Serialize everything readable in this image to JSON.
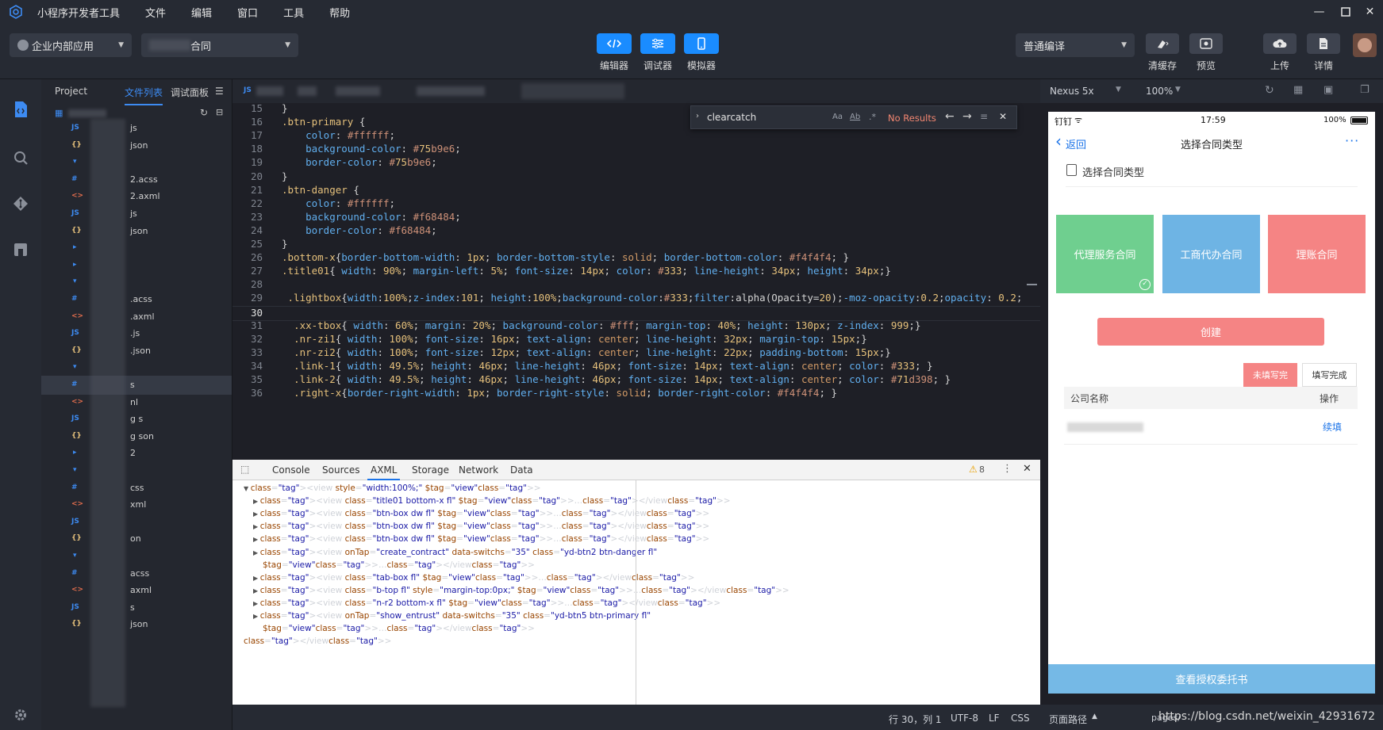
{
  "titlebar": {
    "app_name": "小程序开发者工具",
    "menu": [
      "文件",
      "编辑",
      "窗口",
      "工具",
      "帮助"
    ]
  },
  "toolbar": {
    "app_scope": "企业内部应用",
    "project_name_suffix": "合同",
    "editor_label": "编辑器",
    "debugger_label": "调试器",
    "simulator_label": "模拟器",
    "compile_mode": "普通编译",
    "clear_cache_label": "清缓存",
    "preview_label": "预览",
    "upload_label": "上传",
    "details_label": "详情"
  },
  "tree": {
    "tab_project": "Project",
    "tab_files": "文件列表",
    "tab_debug": "调试面板",
    "rows": [
      {
        "icon": "JS",
        "name": "js"
      },
      {
        "icon": "{}",
        "name": "json"
      },
      {
        "icon": "▾",
        "name": ""
      },
      {
        "icon": "#",
        "name": "2.acss"
      },
      {
        "icon": "<>",
        "name": "2.axml"
      },
      {
        "icon": "JS",
        "name": "js"
      },
      {
        "icon": "{}",
        "name": "json"
      },
      {
        "icon": "▸",
        "name": ""
      },
      {
        "icon": "▸",
        "name": ""
      },
      {
        "icon": "▾",
        "name": ""
      },
      {
        "icon": "#",
        "name": ".acss"
      },
      {
        "icon": "<>",
        "name": ".axml"
      },
      {
        "icon": "JS",
        "name": ".js"
      },
      {
        "icon": "{}",
        "name": ".json"
      },
      {
        "icon": "▾",
        "name": ""
      },
      {
        "icon": "#",
        "name": "s"
      },
      {
        "icon": "<>",
        "name": "nl"
      },
      {
        "icon": "JS",
        "name": "g s"
      },
      {
        "icon": "{}",
        "name": "g son"
      },
      {
        "icon": "▸",
        "name": "2"
      },
      {
        "icon": "▾",
        "name": ""
      },
      {
        "icon": "#",
        "name": "css"
      },
      {
        "icon": "<>",
        "name": "xml"
      },
      {
        "icon": "JS",
        "name": ""
      },
      {
        "icon": "{}",
        "name": "on"
      },
      {
        "icon": "▾",
        "name": ""
      },
      {
        "icon": "#",
        "name": "acss"
      },
      {
        "icon": "<>",
        "name": "axml"
      },
      {
        "icon": "JS",
        "name": "s"
      },
      {
        "icon": "{}",
        "name": "json"
      }
    ]
  },
  "editor": {
    "find_query": "clearcatch",
    "find_result": "No Results",
    "lines": [
      {
        "n": "15",
        "t": "}"
      },
      {
        "n": "16",
        "t": ".btn-primary {"
      },
      {
        "n": "17",
        "t": "    color: #ffffff;"
      },
      {
        "n": "18",
        "t": "    background-color: #75b9e6;"
      },
      {
        "n": "19",
        "t": "    border-color: #75b9e6;"
      },
      {
        "n": "20",
        "t": "}"
      },
      {
        "n": "21",
        "t": ".btn-danger {"
      },
      {
        "n": "22",
        "t": "    color: #ffffff;"
      },
      {
        "n": "23",
        "t": "    background-color: #f68484;"
      },
      {
        "n": "24",
        "t": "    border-color: #f68484;"
      },
      {
        "n": "25",
        "t": "}"
      },
      {
        "n": "26",
        "t": ".bottom-x{border-bottom-width: 1px; border-bottom-style: solid; border-bottom-color: #f4f4f4; }"
      },
      {
        "n": "27",
        "t": ".title01{ width: 90%; margin-left: 5%; font-size: 14px; color: #333; line-height: 34px; height: 34px;}"
      },
      {
        "n": "28",
        "t": ""
      },
      {
        "n": "29",
        "t": " .lightbox{width:100%;z-index:101; height:100%;background-color:#333;filter:alpha(Opacity=20);-moz-opacity:0.2;opacity: 0.2;"
      },
      {
        "n": "30",
        "t": ""
      },
      {
        "n": "31",
        "t": "  .xx-tbox{ width: 60%; margin: 20%; background-color: #fff; margin-top: 40%; height: 130px; z-index: 999;}"
      },
      {
        "n": "32",
        "t": "  .nr-zi1{ width: 100%; font-size: 16px; text-align: center; line-height: 32px; margin-top: 15px;}"
      },
      {
        "n": "33",
        "t": "  .nr-zi2{ width: 100%; font-size: 12px; text-align: center; line-height: 22px; padding-bottom: 15px;}"
      },
      {
        "n": "34",
        "t": "  .link-1{ width: 49.5%; height: 46px; line-height: 46px; font-size: 14px; text-align: center; color: #333; }"
      },
      {
        "n": "35",
        "t": "  .link-2{ width: 49.5%; height: 46px; line-height: 46px; font-size: 14px; text-align: center; color: #71d398; }"
      },
      {
        "n": "36",
        "t": "  .right-x{border-right-width: 1px; border-right-style: solid; border-right-color: #f4f4f4; }"
      }
    ]
  },
  "devtools": {
    "tabs": [
      "Console",
      "Sources",
      "AXML",
      "Storage",
      "Network",
      "Data"
    ],
    "active_tab": "AXML",
    "warning_count": "8",
    "axml_lines": [
      "<view style=\"width:100%;\" $tag=\"view\">",
      "<view class=\"title01 bottom-x fl\" $tag=\"view\">…</view>",
      "<view class=\"btn-box dw fl\" $tag=\"view\">…</view>",
      "<view class=\"btn-box dw fl\" $tag=\"view\">…</view>",
      "<view class=\"btn-box dw fl\" $tag=\"view\">…</view>",
      "<view onTap=\"create_contract\" data-switchs=\"35\" class=\"yd-btn2 btn-danger fl\"",
      "$tag=\"view\">…</view>",
      "<view class=\"tab-box fl\" $tag=\"view\">…</view>",
      "<view class=\"b-top fl\" style=\"margin-top:0px;\" $tag=\"view\">…</view>",
      "<view class=\"n-r2 bottom-x fl\" $tag=\"view\">…</view>",
      "<view onTap=\"show_entrust\" data-switchs=\"35\" class=\"yd-btn5 btn-primary fl\"",
      "$tag=\"view\">…</view>",
      "</view>"
    ]
  },
  "statusbar": {
    "position": "行 30，列 1",
    "encoding": "UTF-8",
    "eol": "LF",
    "language": "CSS",
    "page_path_label": "页面路径",
    "pages_prefix": "pages/",
    "watermark": "https://blog.csdn.net/weixin_42931672"
  },
  "simulator": {
    "device": "Nexus 5x",
    "zoom": "100%",
    "carrier": "钉钉",
    "time": "17:59",
    "battery": "100%",
    "back_label": "返回",
    "nav_title": "选择合同类型",
    "more": "···",
    "section_title": "选择合同类型",
    "cards": [
      {
        "label": "代理服务合同",
        "color": "#6fcf8f"
      },
      {
        "label": "工商代办合同",
        "color": "#6eb4e4"
      },
      {
        "label": "理账合同",
        "color": "#f58484"
      }
    ],
    "create_label": "创建",
    "filter_unfilled": "未填写完",
    "filter_filled": "填写完成",
    "col_company": "公司名称",
    "col_action": "操作",
    "row_action": "续填",
    "bottom_button": "查看授权委托书"
  },
  "colors": {
    "accent": "#1a8cff",
    "danger": "#f58484",
    "primary": "#75b9e6",
    "success": "#6fcf8f"
  }
}
